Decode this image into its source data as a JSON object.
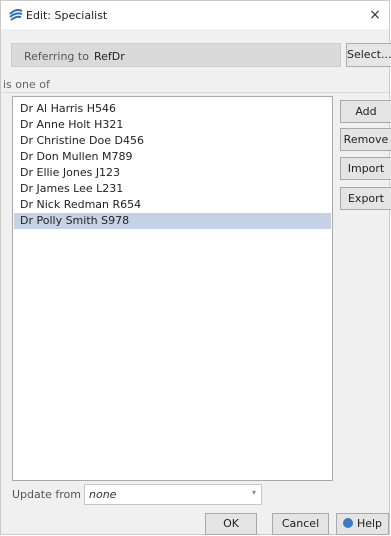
{
  "window": {
    "title": "Edit: Specialist",
    "close_glyph": "×",
    "app_icon": "app-logo-icon"
  },
  "referring": {
    "label": "Referring to",
    "value": "RefDr",
    "select_button": "Select..."
  },
  "section_label": "is one of",
  "list_items": [
    "Dr Al Harris H546",
    "Dr Anne Holt H321",
    "Dr Christine Doe D456",
    "Dr Don Mullen M789",
    "Dr Ellie Jones J123",
    "Dr James Lee L231",
    "Dr Nick Redman R654",
    "Dr Polly Smith S978"
  ],
  "selected_item": "Dr Polly Smith S978",
  "side_buttons": {
    "add": "Add",
    "remove": "Remove",
    "import": "Import",
    "export": "Export"
  },
  "update_from": {
    "label": "Update from",
    "value": "none",
    "arrow": "▾"
  },
  "bottom_buttons": {
    "ok": "OK",
    "cancel": "Cancel",
    "help": "Help",
    "help_icon": "help-icon"
  },
  "colors": {
    "selection": "#c5d2e6",
    "help_icon": "#3d78c9"
  }
}
